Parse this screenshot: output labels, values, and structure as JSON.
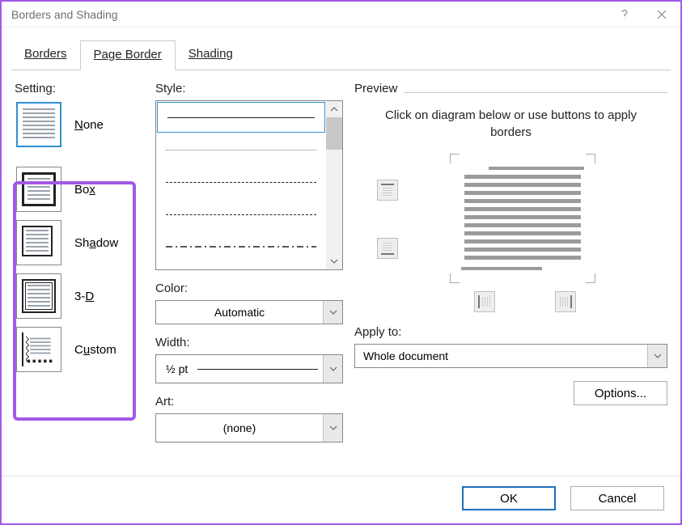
{
  "window": {
    "title": "Borders and Shading"
  },
  "tabs": {
    "borders": "Borders",
    "page_border": "Page Border",
    "shading": "Shading"
  },
  "setting": {
    "label": "Setting:",
    "none": "None",
    "box": "Box",
    "shadow": "Shadow",
    "three_d": "3-D",
    "custom": "Custom"
  },
  "style": {
    "label": "Style:"
  },
  "color": {
    "label": "Color:",
    "value": "Automatic"
  },
  "width": {
    "label": "Width:",
    "value": "½ pt"
  },
  "art": {
    "label": "Art:",
    "value": "(none)"
  },
  "preview": {
    "label": "Preview",
    "hint": "Click on diagram below or use buttons to apply borders"
  },
  "apply_to": {
    "label": "Apply to:",
    "value": "Whole document"
  },
  "buttons": {
    "options": "Options...",
    "ok": "OK",
    "cancel": "Cancel"
  }
}
